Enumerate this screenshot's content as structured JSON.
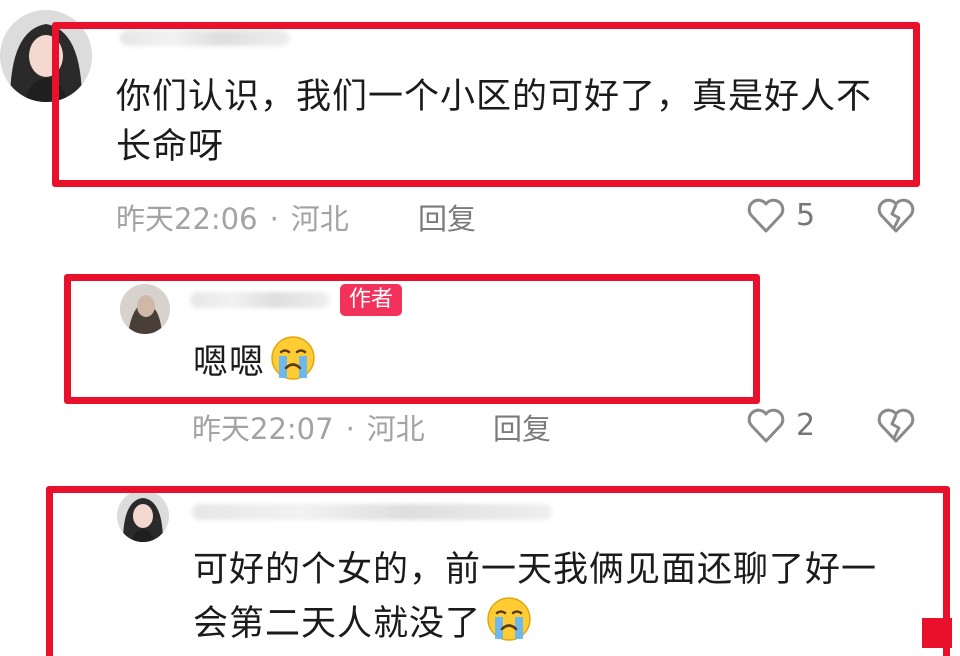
{
  "comments": [
    {
      "text": "你们认识，我们一个小区的可好了，真是好人不长命呀",
      "time": "昨天22:06",
      "location": "河北",
      "reply_label": "回复",
      "likes": "5",
      "separator": "·"
    },
    {
      "author_badge": "作者",
      "text": "嗯嗯",
      "time": "昨天22:07",
      "location": "河北",
      "reply_label": "回复",
      "likes": "2",
      "separator": "·"
    },
    {
      "text": "可好的个女的，前一天我俩见面还聊了好一会第二天人就没了"
    }
  ],
  "colors": {
    "highlight_border": "#e8102b",
    "author_badge_bg": "#f2325a",
    "meta_text": "#a3a3a3"
  },
  "icons": {
    "like": "heart-outline-icon",
    "dislike": "broken-heart-icon",
    "emoji": "crying-face-emoji-icon"
  }
}
